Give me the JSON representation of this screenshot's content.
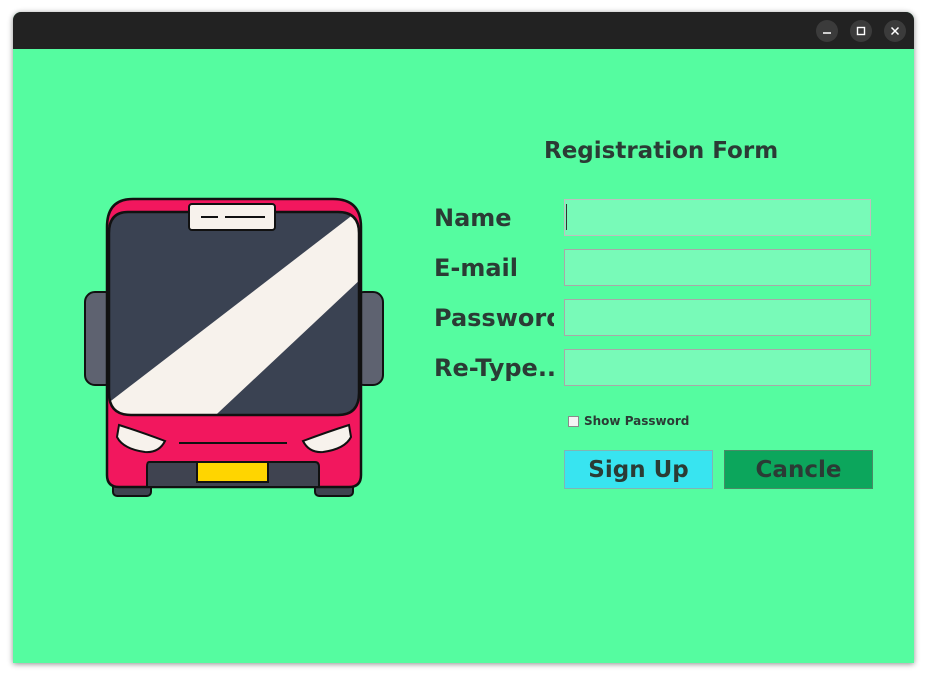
{
  "window": {
    "controls": {
      "minimize_icon": "minimize-icon",
      "maximize_icon": "maximize-icon",
      "close_icon": "close-icon"
    }
  },
  "form": {
    "title": "Registration Form",
    "fields": [
      {
        "label": "Name",
        "value": "",
        "placeholder": ""
      },
      {
        "label": "E-mail",
        "value": "",
        "placeholder": ""
      },
      {
        "label": "Password",
        "value": "",
        "placeholder": ""
      },
      {
        "label": "Re-Type...",
        "value": "",
        "placeholder": ""
      }
    ],
    "show_password": {
      "label": "Show Password",
      "checked": false
    },
    "signup_label": "Sign Up",
    "cancel_label": "Cancle"
  },
  "colors": {
    "background": "#55fca0",
    "field_background": "#78fab8",
    "signup_button": "#38e4f0",
    "cancel_button": "#0ca65c",
    "titlebar": "#222222",
    "bus_body": "#f2175e",
    "bus_window": "#3a4252"
  },
  "illustration": {
    "icon": "bus-icon"
  }
}
